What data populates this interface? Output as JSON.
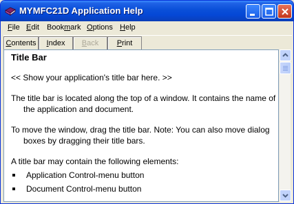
{
  "window": {
    "title": "MYMFC21D Application Help"
  },
  "menu": {
    "items": [
      {
        "pre": "",
        "acc": "F",
        "post": "ile"
      },
      {
        "pre": "",
        "acc": "E",
        "post": "dit"
      },
      {
        "pre": "Book",
        "acc": "m",
        "post": "ark"
      },
      {
        "pre": "",
        "acc": "O",
        "post": "ptions"
      },
      {
        "pre": "",
        "acc": "H",
        "post": "elp"
      }
    ]
  },
  "toolbar": {
    "contents": {
      "pre": "",
      "acc": "C",
      "post": "ontents"
    },
    "index": {
      "pre": "",
      "acc": "I",
      "post": "ndex"
    },
    "back": {
      "pre": "",
      "acc": "B",
      "post": "ack"
    },
    "print": {
      "pre": "",
      "acc": "P",
      "post": "rint"
    }
  },
  "content": {
    "heading": "Title Bar",
    "placeholder": "<< Show your application's title bar here. >>",
    "para1": "The title bar is located along the top of a window.  It contains the name of the application and document.",
    "para2": "To move the window, drag the title bar.  Note: You can also move dialog boxes by dragging their title bars.",
    "para3": "A title bar may contain the following elements:",
    "bullets": [
      "Application Control-menu button",
      "Document Control-menu button"
    ]
  },
  "colors": {
    "titlebar": "#0a4fd8",
    "close_button": "#c2351b",
    "face": "#ece9d8"
  }
}
